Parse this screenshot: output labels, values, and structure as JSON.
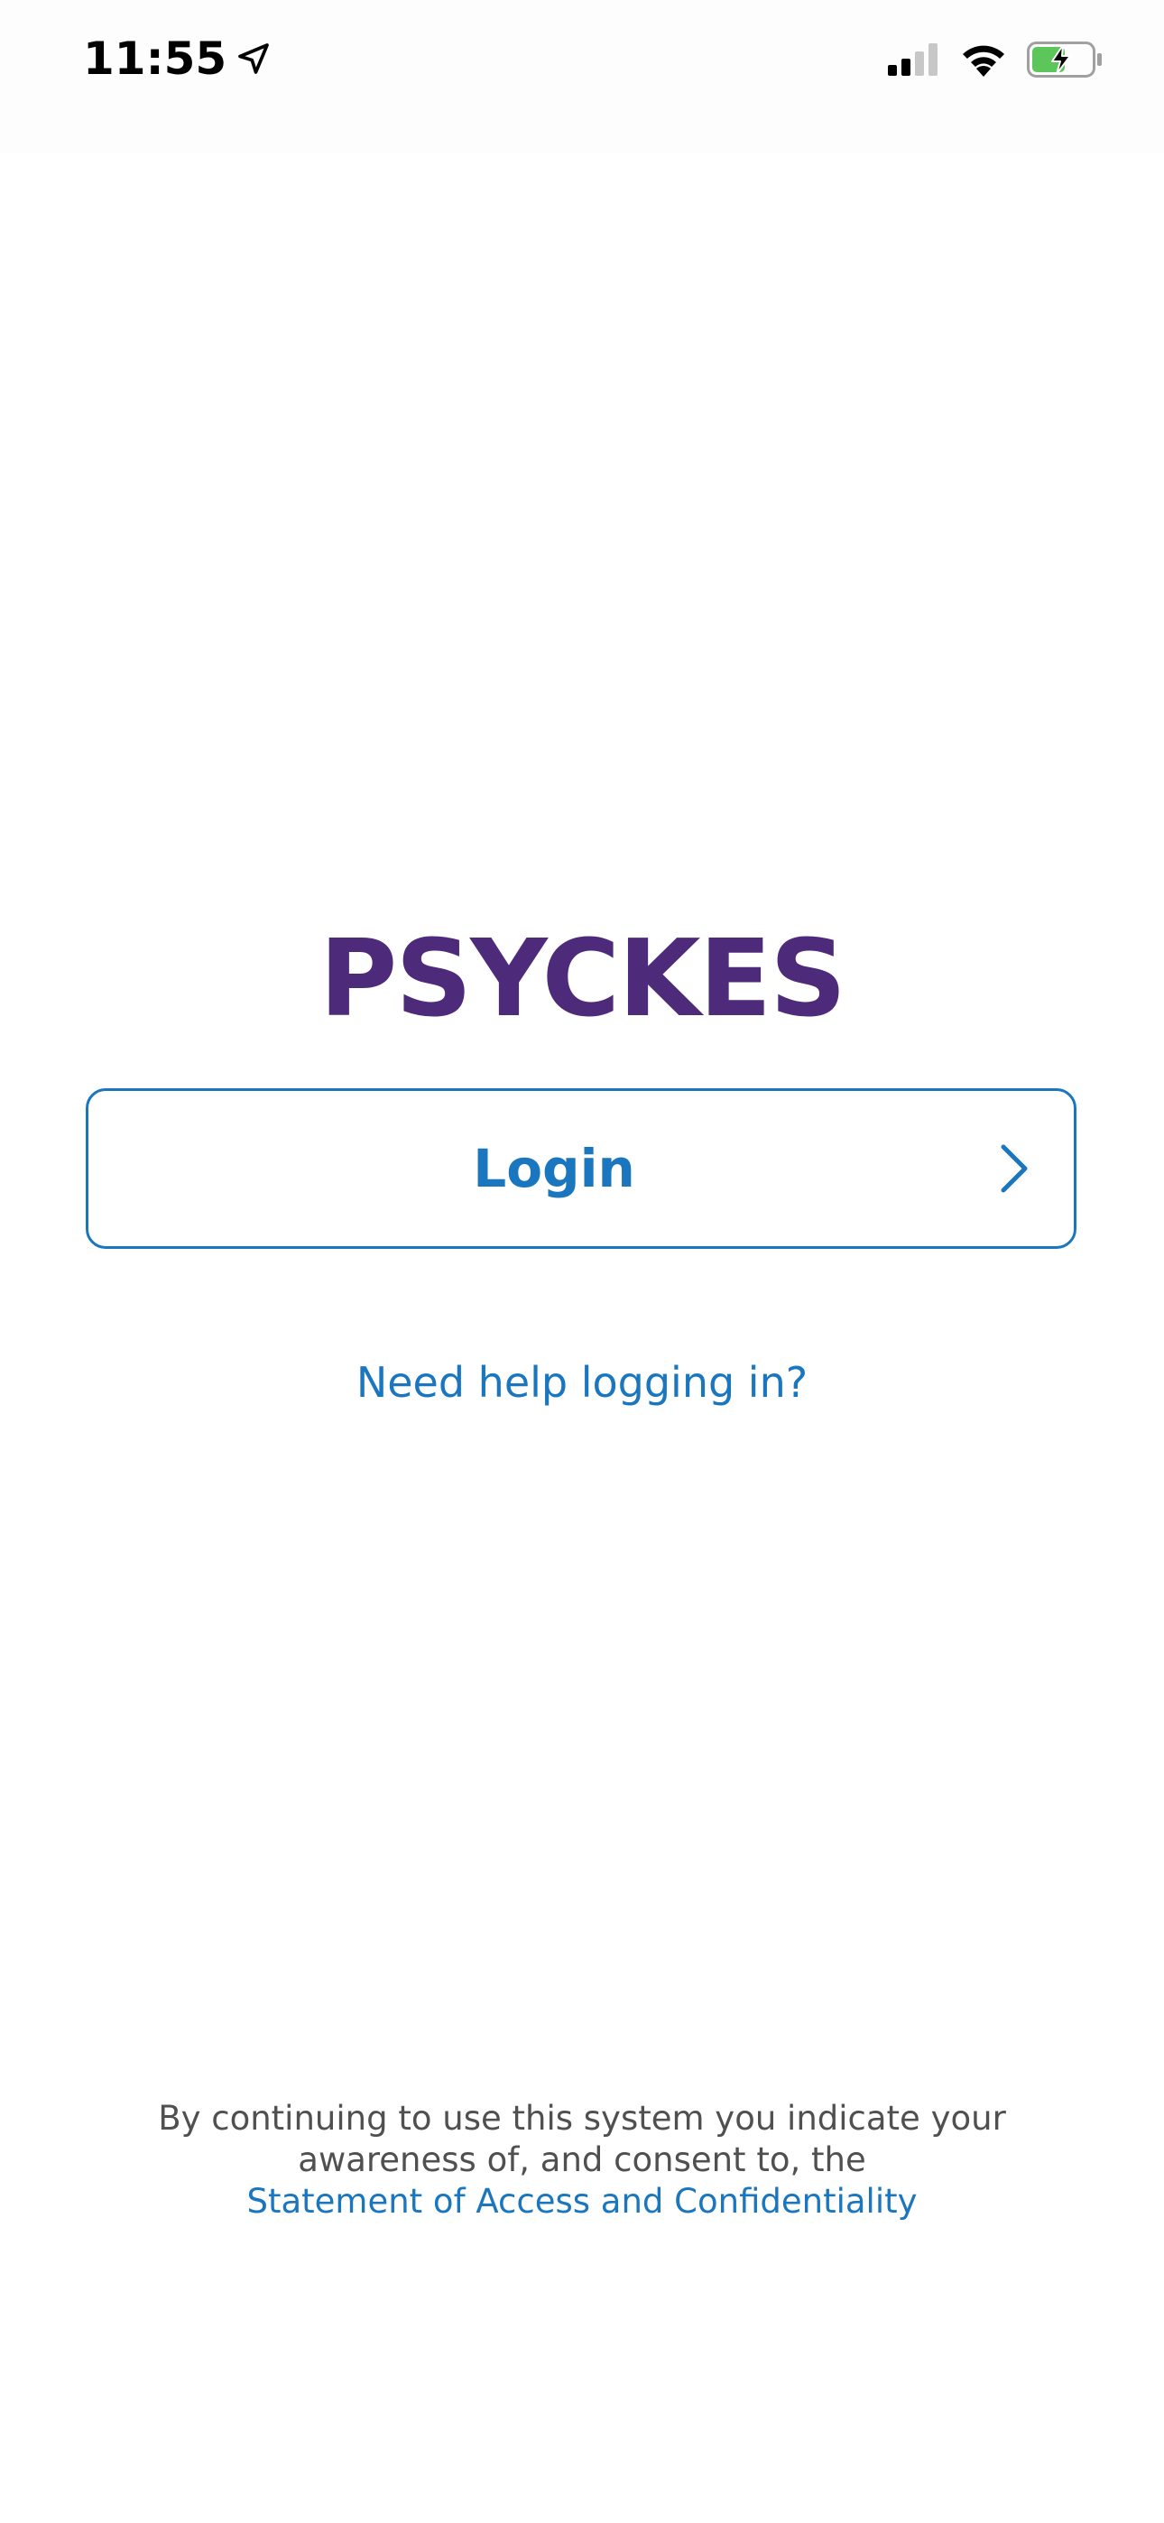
{
  "status_bar": {
    "time": "11:55",
    "icons": [
      "location-arrow-icon",
      "cellular-signal-icon",
      "wifi-icon",
      "battery-charging-icon"
    ],
    "battery_color": "#5dc65a"
  },
  "app": {
    "title": "PSYCKES",
    "title_color": "#4e2a7a",
    "accent_color": "#1a76be"
  },
  "login": {
    "label": "Login"
  },
  "help": {
    "label": "Need help logging in?"
  },
  "consent": {
    "line1": "By continuing to use this system you indicate your",
    "line2": "awareness of, and consent to, the",
    "link_label": "Statement of Access and Confidentiality"
  }
}
